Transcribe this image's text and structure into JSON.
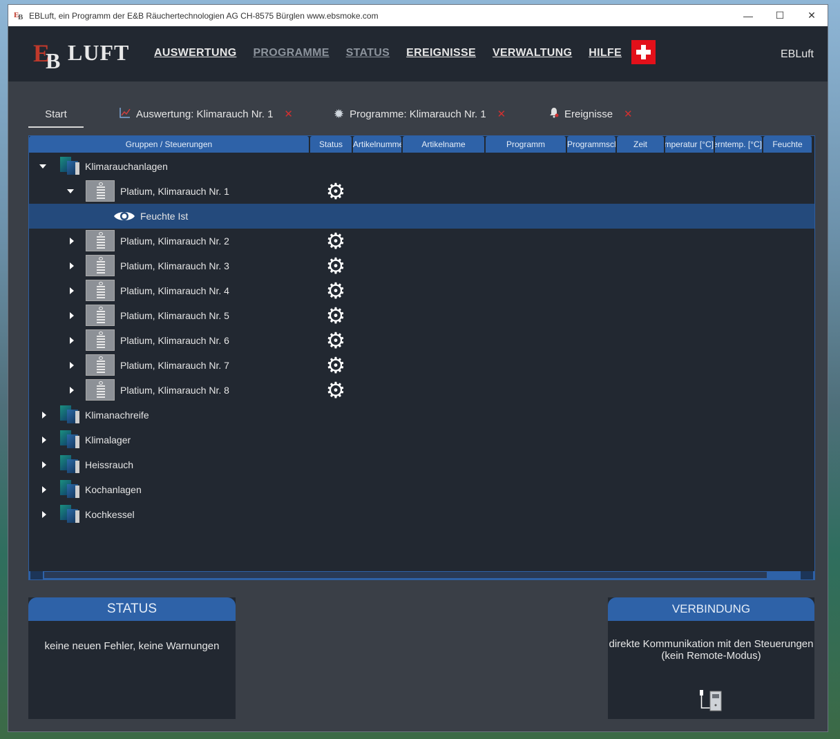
{
  "window": {
    "title": "EBLuft, ein Programm der E&B Räuchertechnologien AG CH-8575 Bürglen www.ebsmoke.com",
    "controls": {
      "minimize": "—",
      "maximize": "☐",
      "close": "✕"
    }
  },
  "logo": {
    "e": "E",
    "b": "B",
    "text": "LUFT"
  },
  "menu": [
    {
      "label": "AUSWERTUNG",
      "dim": false
    },
    {
      "label": "PROGRAMME",
      "dim": true
    },
    {
      "label": "STATUS",
      "dim": true
    },
    {
      "label": "EREIGNISSE",
      "dim": false
    },
    {
      "label": "VERWALTUNG",
      "dim": false
    },
    {
      "label": "HILFE",
      "dim": false
    }
  ],
  "user": "EBLuft",
  "tabs": {
    "start": "Start",
    "items": [
      {
        "icon": "chart-icon",
        "label": "Auswertung: Klimarauch Nr. 1",
        "close": "✕"
      },
      {
        "icon": "gear-icon",
        "label": "Programme: Klimarauch Nr. 1",
        "close": "✕"
      },
      {
        "icon": "bell-icon",
        "label": "Ereignisse",
        "close": "✕"
      }
    ]
  },
  "columns": [
    "Gruppen / Steuerungen",
    "Status",
    "Artikelnummer",
    "Artikelname",
    "Programm",
    "Programmschritt",
    "Zeit",
    "Temperatur [°C]",
    "Kerntemp. [°C]",
    "Feuchte"
  ],
  "tree": {
    "root": "Klimarauchanlagen",
    "devices": [
      "Platium, Klimarauch Nr. 1",
      "Platium, Klimarauch Nr. 2",
      "Platium, Klimarauch Nr. 3",
      "Platium, Klimarauch Nr. 4",
      "Platium, Klimarauch Nr. 5",
      "Platium, Klimarauch Nr. 6",
      "Platium, Klimarauch Nr. 7",
      "Platium, Klimarauch Nr. 8"
    ],
    "child": "Feuchte Ist",
    "groups": [
      "Klimanachreife",
      "Klimalager",
      "Heissrauch",
      "Kochanlagen",
      "Kochkessel"
    ]
  },
  "status_panel": {
    "title": "STATUS",
    "text": "keine neuen Fehler, keine Warnungen"
  },
  "connection_panel": {
    "title": "VERBINDUNG",
    "line1": "direkte Kommunikation mit den Steuerungen",
    "line2": "(kein Remote-Modus)"
  },
  "colors": {
    "accent": "#2e62a8",
    "background": "#222831",
    "selection": "#244a7c",
    "close_x": "#d03030",
    "swiss_red": "#e3101a"
  }
}
